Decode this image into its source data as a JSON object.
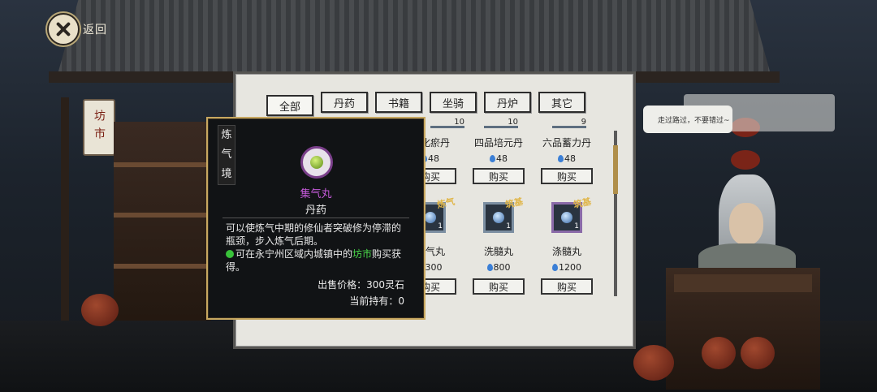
{
  "back": {
    "label": "返回"
  },
  "sign": {
    "text": "坊市"
  },
  "npc_bubble": {
    "text": "走过路过，不要错过~"
  },
  "tabs": [
    {
      "label": "全部",
      "active": true
    },
    {
      "label": "丹药"
    },
    {
      "label": "书籍"
    },
    {
      "label": "坐骑"
    },
    {
      "label": "丹炉"
    },
    {
      "label": "其它"
    }
  ],
  "items": [
    {
      "name": "…化瘀丹",
      "qty": "10",
      "price": "48",
      "buy": "购买"
    },
    {
      "name": "四品培元丹",
      "qty": "10",
      "price": "48",
      "buy": "购买"
    },
    {
      "name": "六品蓄力丹",
      "qty": "9",
      "price": "48",
      "buy": "购买"
    },
    {
      "name": "…气丸",
      "stamp": "炼气",
      "count": "1",
      "price": "300",
      "buy": "购买"
    },
    {
      "name": "洗髓丸",
      "stamp": "筑基",
      "count": "1",
      "price": "800",
      "buy": "购买"
    },
    {
      "name": "涤髓丸",
      "stamp": "筑基",
      "count": "1",
      "price": "1200",
      "buy": "购买"
    }
  ],
  "tooltip": {
    "realm": "炼气境",
    "name": "集气丸",
    "category": "丹药",
    "description": "可以使炼气中期的修仙者突破修为停滞的瓶颈，步入炼气后期。",
    "source_pre": "可在永宁州区域内城镇中的",
    "source_highlight": "坊市",
    "source_post": "购买获得。",
    "sell_price": "出售价格：300灵石",
    "holding": "当前持有：0"
  },
  "colors": {
    "accent_gold": "#c8a860",
    "item_name_purple": "#c45ad8",
    "source_green": "#4ad94a",
    "gem_blue": "#3b7fd6"
  }
}
